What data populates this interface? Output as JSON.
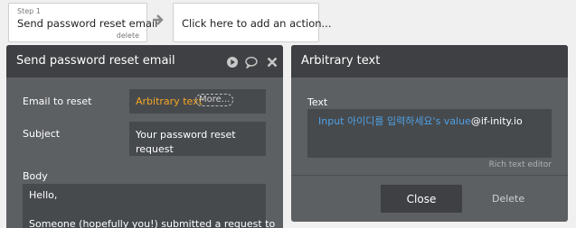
{
  "workflow": {
    "step_number": "Step 1",
    "step_title": "Send password reset email",
    "step_delete": "delete",
    "add_action": "Click here to add an action..."
  },
  "left_panel": {
    "title": "Send password reset email",
    "icons": [
      "play-icon",
      "comment-icon",
      "close-icon"
    ],
    "email_label": "Email to reset",
    "email_value": "Arbitrary text",
    "more_label": "More...",
    "subject_label": "Subject",
    "subject_value": "Your password reset request",
    "body_label": "Body",
    "body_line1": "Hello,",
    "body_line2": "Someone (hopefully you!) submitted a request to"
  },
  "right_panel": {
    "title": "Arbitrary text",
    "text_label": "Text",
    "rich_text_blue": "Input 아이디를 입력하세요's value",
    "rich_text_plain": "@if-inity.io",
    "rich_text_editor": "Rich text editor",
    "close_label": "Close",
    "delete_label": "Delete"
  },
  "colors": {
    "panel_bg": "#5d6063",
    "panel_header": "#3e4043",
    "field_bg": "#474a4d",
    "dynamic_orange": "#f5a623",
    "dynamic_blue": "#4ea1e6"
  }
}
